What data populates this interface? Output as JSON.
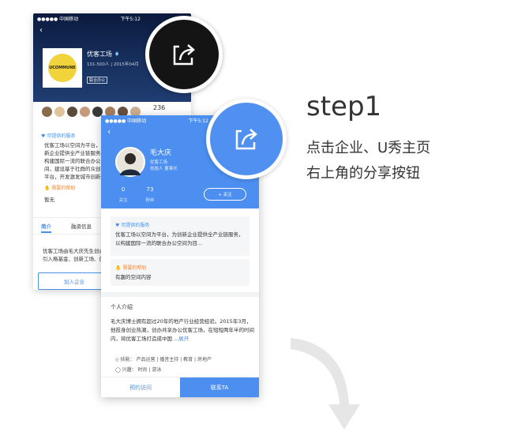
{
  "back_phone": {
    "carrier": "●●●●● 中国移动 ",
    "time": "下午5:12",
    "company_name": "优客工场 ",
    "company_meta": "101-500人  |  2015年04月",
    "company_tag": "联合办公",
    "logo_text": "UCOMMUNE",
    "member_count": "236",
    "services_title": "可提供的服务",
    "services_text": "优客工场以空间为平台，为创新企业提供全产业链服务，以构建国际一流的联合办公空间，建设基于社群的众创生态平台，开发激发城市创新活力",
    "need_title": "需要的帮助",
    "need_text": "暂无",
    "tab_intro": "简介",
    "tab_finance": "融资信息",
    "intro_text": "优客工场由毛大庆先生创办，引入格基金、创新工场、创",
    "join_button": "加入企业"
  },
  "front_phone": {
    "carrier": "●●●●● 中国移动 ",
    "time": "下午5:12",
    "name": "毛大庆",
    "company": "优客工场",
    "role": "创始人  董事长",
    "stat_follow_value": "0",
    "stat_follow_label": "关注",
    "stat_fans_value": "73",
    "stat_fans_label": "粉丝",
    "follow_button": "+ 关注",
    "services_title": "可提供的服务",
    "services_text": "优客工场以空间为平台，为创新企业提供全产业链服务，以构建国际一流的联合办公空间为目...",
    "need_title": "需要的帮助",
    "need_text": "有趣的空间内容",
    "bio_heading": "个人介绍",
    "bio_text": "毛大庆博士拥有超过20年的地产行业经营经验。2015年3月，他投身创业热潮，创办共享办公优客工场，在短短两年半的时间内，将优客工场打造成中国 ...",
    "bio_more": "展开",
    "skills": "技能：  产品运营 | 播音主持 | 教育 | 房地产",
    "interests": "兴趣：  时尚 | 游泳",
    "visit_button": "预约访问",
    "contact_button": "联系TA"
  },
  "step_title": "step1",
  "step_desc_line1": "点击企业、U秀主页",
  "step_desc_line2": "右上角的分享按钮",
  "colors": {
    "accent_blue": "#4c8ff0",
    "dark_circle": "#141414",
    "need_orange": "#f08a3c",
    "arrow_gray": "#e6e6e6"
  }
}
